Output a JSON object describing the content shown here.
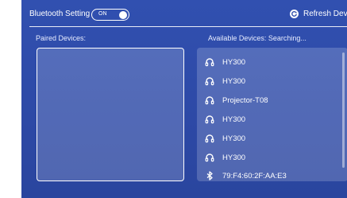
{
  "header": {
    "bluetooth_label": "Bluetooth Setting",
    "toggle_state": "ON",
    "refresh_label": "Refresh Device"
  },
  "paired": {
    "label": "Paired Devices:"
  },
  "available": {
    "label": "Available Devices:  Searching...",
    "devices": [
      {
        "name": "HY300",
        "icon": "headphones-icon"
      },
      {
        "name": "HY300",
        "icon": "headphones-icon"
      },
      {
        "name": "Projector-T08",
        "icon": "headphones-icon"
      },
      {
        "name": "HY300",
        "icon": "headphones-icon"
      },
      {
        "name": "HY300",
        "icon": "headphones-icon"
      },
      {
        "name": "HY300",
        "icon": "headphones-icon"
      },
      {
        "name": "79:F4:60:2F:AA:E3",
        "icon": "bluetooth-icon"
      }
    ]
  },
  "colors": {
    "panel_bg": "#2f4dab",
    "text": "#ffffff"
  }
}
